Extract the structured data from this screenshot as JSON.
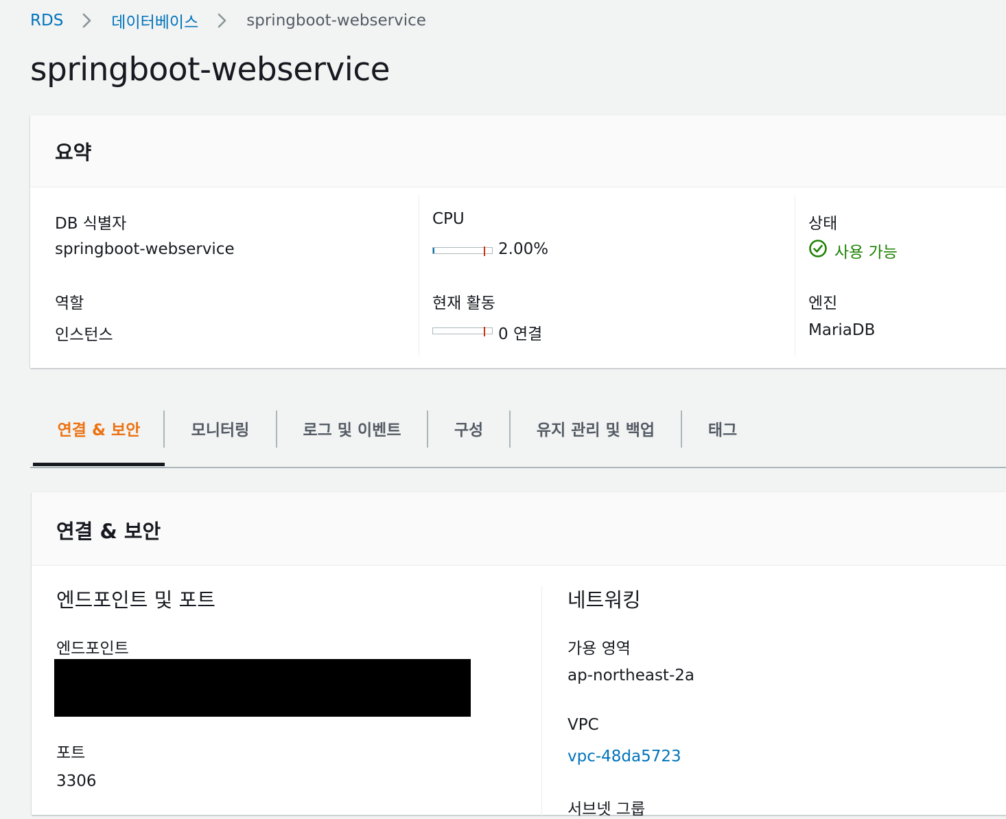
{
  "breadcrumb": {
    "items": [
      "RDS",
      "데이터베이스",
      "springboot-webservice"
    ]
  },
  "page_title": "springboot-webservice",
  "summary": {
    "title": "요약",
    "db_identifier_label": "DB 식별자",
    "db_identifier_value": "springboot-webservice",
    "role_label": "역할",
    "role_value": "인스턴스",
    "cpu_label": "CPU",
    "cpu_value": "2.00%",
    "cpu_fraction": 0.02,
    "activity_label": "현재 활동",
    "activity_value": "0 연결",
    "status_label": "상태",
    "status_value": "사용 가능",
    "engine_label": "엔진",
    "engine_value": "MariaDB"
  },
  "tabs": [
    {
      "label": "연결 & 보안",
      "active": true
    },
    {
      "label": "모니터링",
      "active": false
    },
    {
      "label": "로그 및 이벤트",
      "active": false
    },
    {
      "label": "구성",
      "active": false
    },
    {
      "label": "유지 관리 및 백업",
      "active": false
    },
    {
      "label": "태그",
      "active": false
    }
  ],
  "connectivity": {
    "title": "연결 & 보안",
    "endpoint_section_title": "엔드포인트 및 포트",
    "endpoint_label": "엔드포인트",
    "port_label": "포트",
    "port_value": "3306",
    "networking_title": "네트워킹",
    "az_label": "가용 영역",
    "az_value": "ap-northeast-2a",
    "vpc_label": "VPC",
    "vpc_value": "vpc-48da5723",
    "subnet_group_label": "서브넷 그룹"
  },
  "colors": {
    "link": "#0073bb",
    "active_tab": "#ec7211",
    "status_ok": "#1d8102",
    "meter_mark": "#d13212"
  },
  "icons": {
    "breadcrumb_separator": "chevron-right-icon",
    "status": "check-circle-icon"
  }
}
